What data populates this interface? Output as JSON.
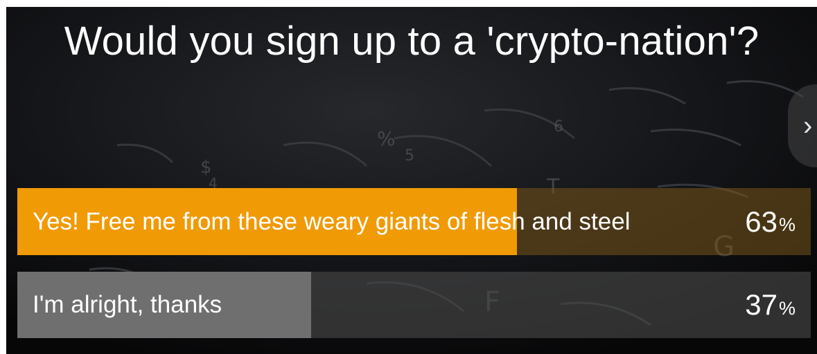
{
  "poll": {
    "question": "Would you sign up to a 'crypto-nation'?",
    "options": [
      {
        "label": "Yes! Free me from these weary giants of flesh and steel",
        "percent": "63",
        "percent_symbol": "%",
        "fill_fraction": 0.63,
        "fill_color": "#f09a06"
      },
      {
        "label": "I'm alright, thanks",
        "percent": "37",
        "percent_symbol": "%",
        "fill_fraction": 0.37,
        "fill_color": "#6f6f6f"
      }
    ],
    "next_icon": "chevron-right-icon"
  }
}
